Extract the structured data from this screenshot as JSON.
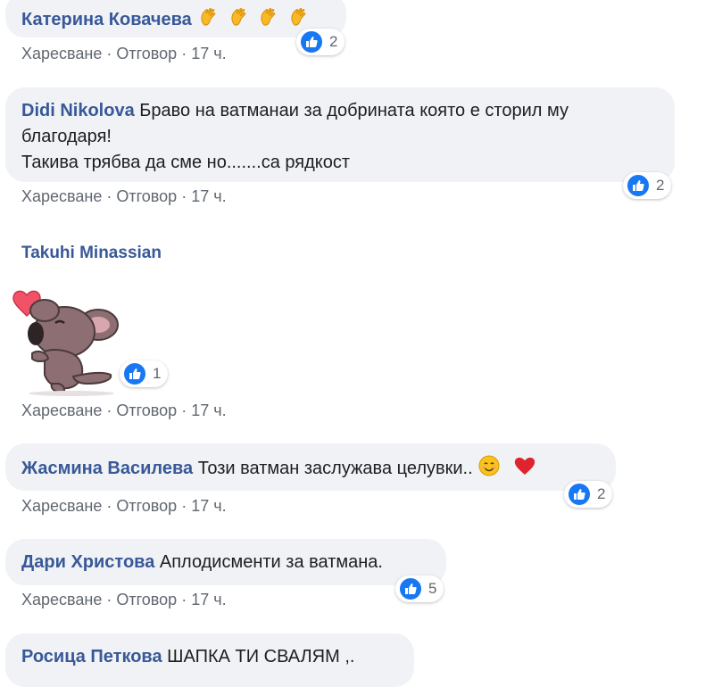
{
  "comments": [
    {
      "author": "Катерина Ковачева",
      "text": "",
      "emoji": [
        "clapping-hands",
        "clapping-hands",
        "clapping-hands",
        "clapping-hands"
      ],
      "reactions": "2",
      "like_label": "Харесване",
      "reply_label": "Отговор",
      "time": "17 ч."
    },
    {
      "author": "Didi Nikolova",
      "text_line1": "Браво на ватманаи за добрината която е сторил му",
      "text_line2": "благодаря!",
      "text_line3": "Такива трябва да сме но.......са рядкост",
      "reactions": "2",
      "like_label": "Харесване",
      "reply_label": "Отговор",
      "time": "17 ч."
    },
    {
      "author": "Takuhi Minassian",
      "sticker": "koala-blowing-kiss-heart",
      "reactions": "1",
      "like_label": "Харесване",
      "reply_label": "Отговор",
      "time": "17 ч."
    },
    {
      "author": "Жасмина Василева",
      "text": "Този ватман заслужава целувки..",
      "emoji": [
        "smiling-face",
        "red-heart"
      ],
      "reactions": "2",
      "like_label": "Харесване",
      "reply_label": "Отговор",
      "time": "17 ч."
    },
    {
      "author": "Дари Христова",
      "text": "Аплодисменти за ватмана.",
      "reactions": "5",
      "like_label": "Харесване",
      "reply_label": "Отговор",
      "time": "17 ч."
    },
    {
      "author": "Росица Петкова",
      "text": "ШАПКА ТИ СВАЛЯМ ,."
    }
  ],
  "separator": "·",
  "colors": {
    "author": "#385898",
    "like_blue": "#1877f2",
    "bubble": "#f0f2f5",
    "meta": "#616770"
  }
}
